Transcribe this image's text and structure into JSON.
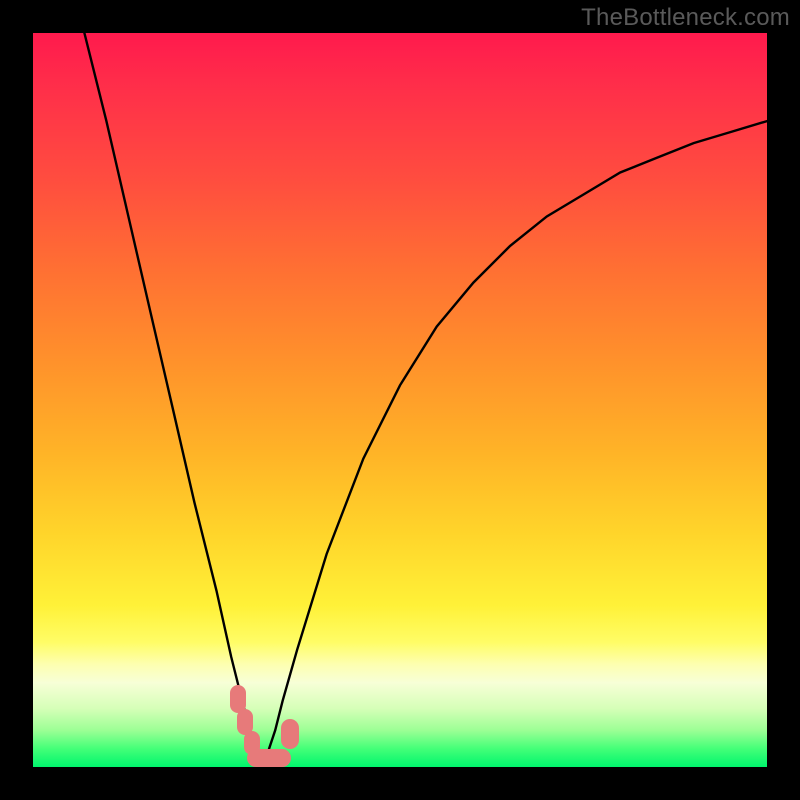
{
  "watermark": "TheBottleneck.com",
  "colors": {
    "background": "#000000",
    "curve": "#000000",
    "marker": "#e77a7a",
    "gradient_top": "#ff1a4d",
    "gradient_bottom": "#00f56d"
  },
  "chart_data": {
    "type": "line",
    "title": "",
    "xlabel": "",
    "ylabel": "",
    "xlim": [
      0,
      100
    ],
    "ylim": [
      0,
      100
    ],
    "curve": {
      "description": "Absolute-deviation style bottleneck curve; y is mismatch percentage (0 = balanced), minimum near x≈31",
      "x": [
        7,
        10,
        13,
        16,
        19,
        22,
        25,
        27,
        29,
        30,
        31,
        32,
        33,
        34,
        36,
        40,
        45,
        50,
        55,
        60,
        65,
        70,
        75,
        80,
        85,
        90,
        95,
        100
      ],
      "y": [
        100,
        88,
        75,
        62,
        49,
        36,
        24,
        15,
        7,
        3,
        0,
        2,
        5,
        9,
        16,
        29,
        42,
        52,
        60,
        66,
        71,
        75,
        78,
        81,
        83,
        85,
        86.5,
        88
      ]
    },
    "highlight_region": {
      "x_start": 27.5,
      "x_end": 34.5,
      "description": "Salmon rounded markers near the minimum of the curve"
    }
  }
}
